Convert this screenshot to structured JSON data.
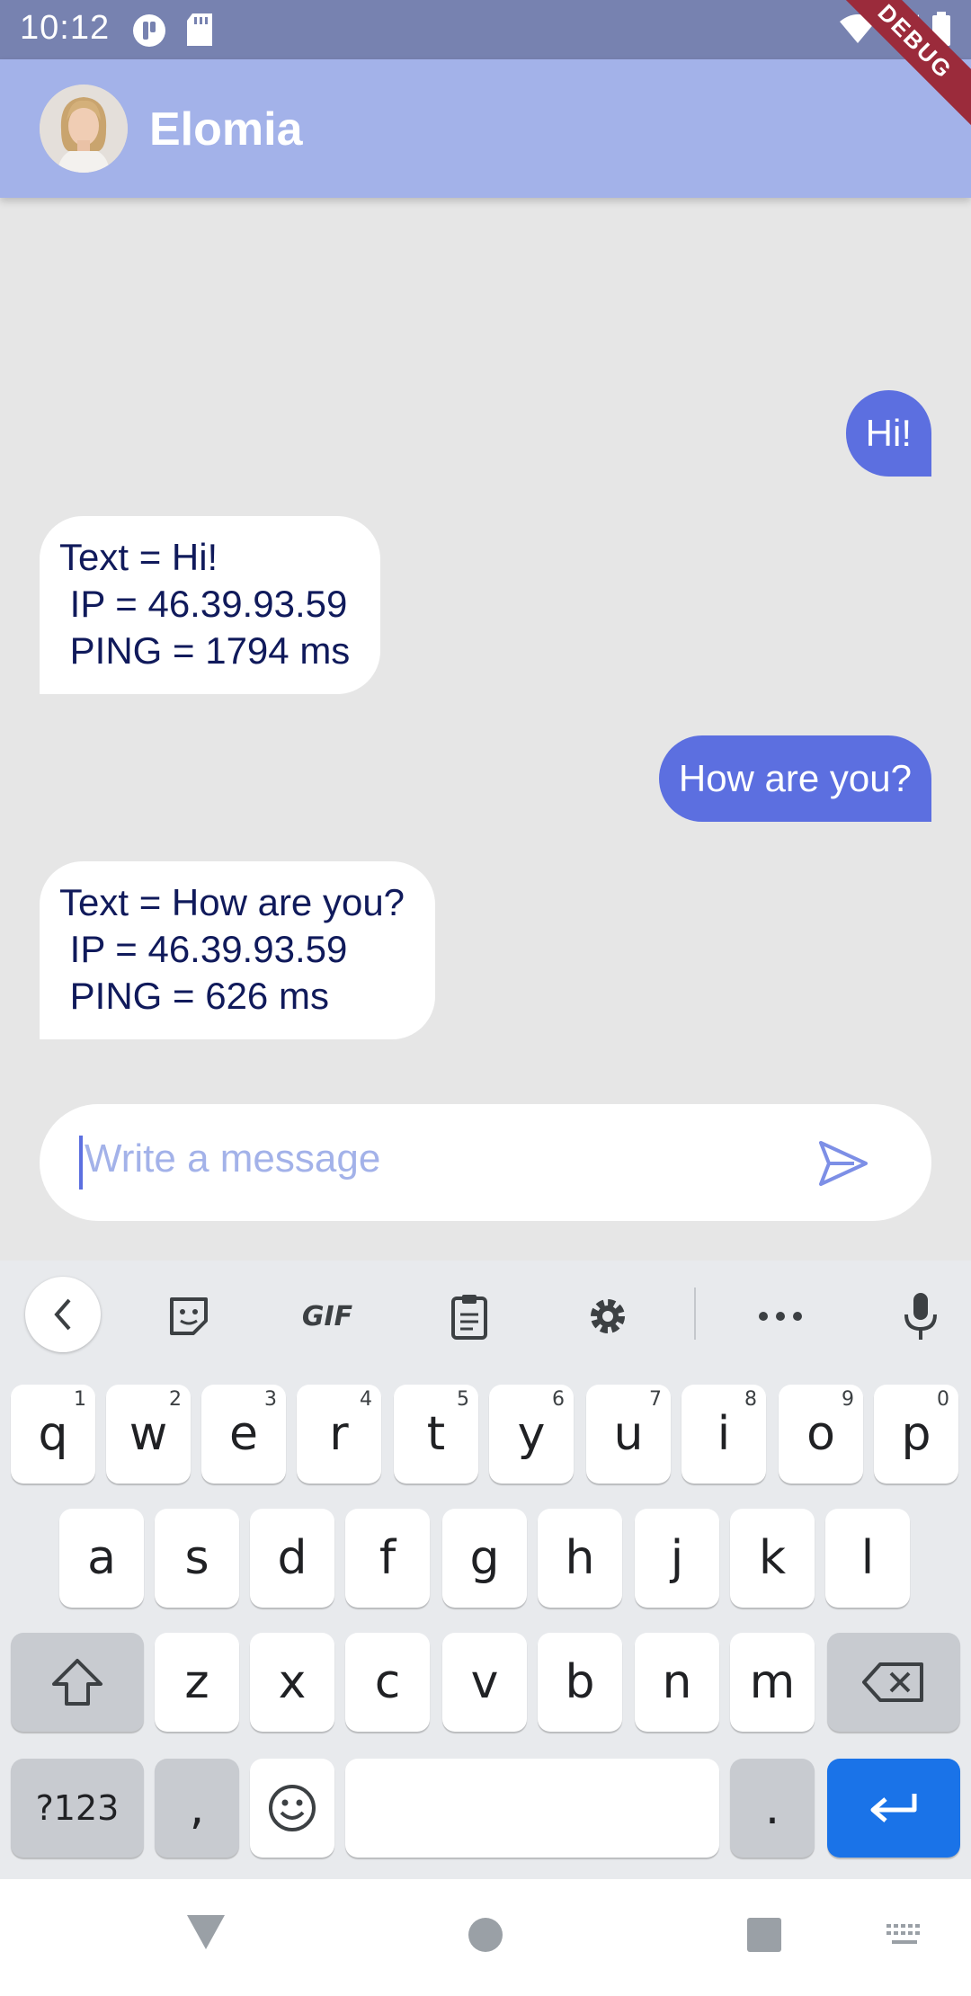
{
  "status_bar": {
    "time": "10:12"
  },
  "app_bar": {
    "title": "Elomia",
    "debug_label": "DEBUG"
  },
  "messages": [
    {
      "from": "user",
      "text": "Hi!"
    },
    {
      "from": "bot",
      "text": "Text = Hi!\n IP = 46.39.93.59\n PING = 1794 ms"
    },
    {
      "from": "user",
      "text": "How are you?"
    },
    {
      "from": "bot",
      "text": "Text = How are you?\n IP = 46.39.93.59\n PING = 626 ms"
    }
  ],
  "input": {
    "placeholder": "Write a message"
  },
  "keyboard": {
    "toolbar": {
      "gif": "GIF"
    },
    "row1": [
      {
        "k": "q",
        "n": "1"
      },
      {
        "k": "w",
        "n": "2"
      },
      {
        "k": "e",
        "n": "3"
      },
      {
        "k": "r",
        "n": "4"
      },
      {
        "k": "t",
        "n": "5"
      },
      {
        "k": "y",
        "n": "6"
      },
      {
        "k": "u",
        "n": "7"
      },
      {
        "k": "i",
        "n": "8"
      },
      {
        "k": "o",
        "n": "9"
      },
      {
        "k": "p",
        "n": "0"
      }
    ],
    "row2": [
      "a",
      "s",
      "d",
      "f",
      "g",
      "h",
      "j",
      "k",
      "l"
    ],
    "row3": [
      "z",
      "x",
      "c",
      "v",
      "b",
      "n",
      "m"
    ],
    "symbols": "?123",
    "comma": ",",
    "period": "."
  },
  "colors": {
    "accent": "#5c6fe0",
    "app_bar": "#a3b2e9",
    "status_bar": "#7782b0",
    "enter_key": "#1a73e8"
  }
}
